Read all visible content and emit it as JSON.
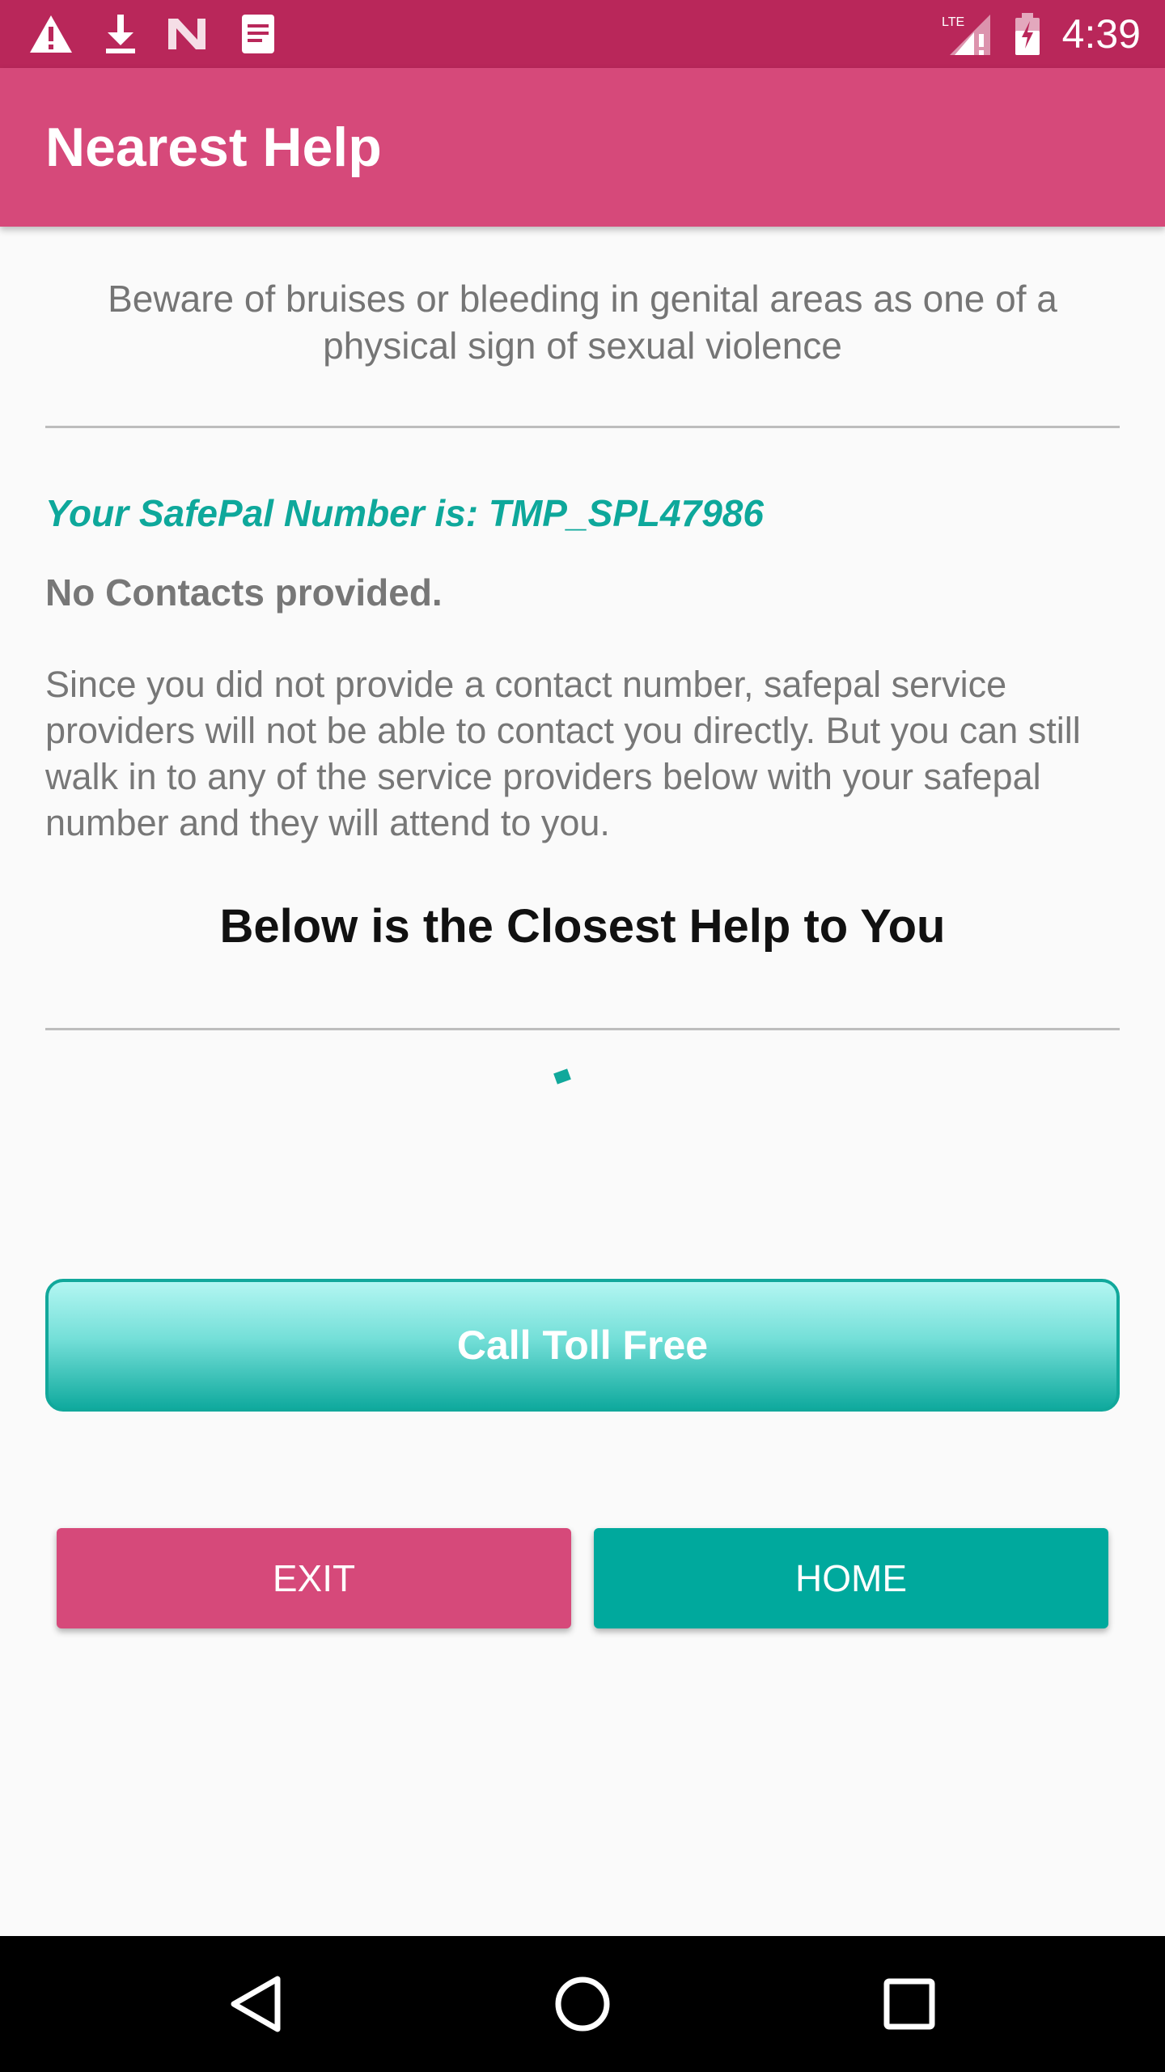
{
  "status_bar": {
    "time": "4:39",
    "network_label": "LTE",
    "icons": [
      "warning-icon",
      "download-icon",
      "notification-n-icon",
      "document-icon",
      "signal-icon",
      "battery-icon"
    ]
  },
  "app_bar": {
    "title": "Nearest Help"
  },
  "content": {
    "tip": "Beware of bruises or bleeding in genital areas as one of a physical sign of sexual violence",
    "safepal_number": "Your SafePal Number is: TMP_SPL47986",
    "no_contacts": "No Contacts provided.",
    "explanation": "Since you did not provide a contact number, safepal service providers will not be able to contact you directly. But you can still walk in to any of the service providers below with your safepal number and they will attend to you.",
    "closest_title": "Below is the Closest Help to You"
  },
  "actions": {
    "call_label": "Call Toll Free",
    "exit_label": "EXIT",
    "home_label": "HOME"
  },
  "nav_bar": {
    "icons": [
      "back-icon",
      "home-circle-icon",
      "recents-icon"
    ]
  },
  "colors": {
    "status_bar": "#b9275a",
    "app_bar": "#d6497a",
    "accent_teal": "#00a99d",
    "exit_button": "#d6497a"
  }
}
